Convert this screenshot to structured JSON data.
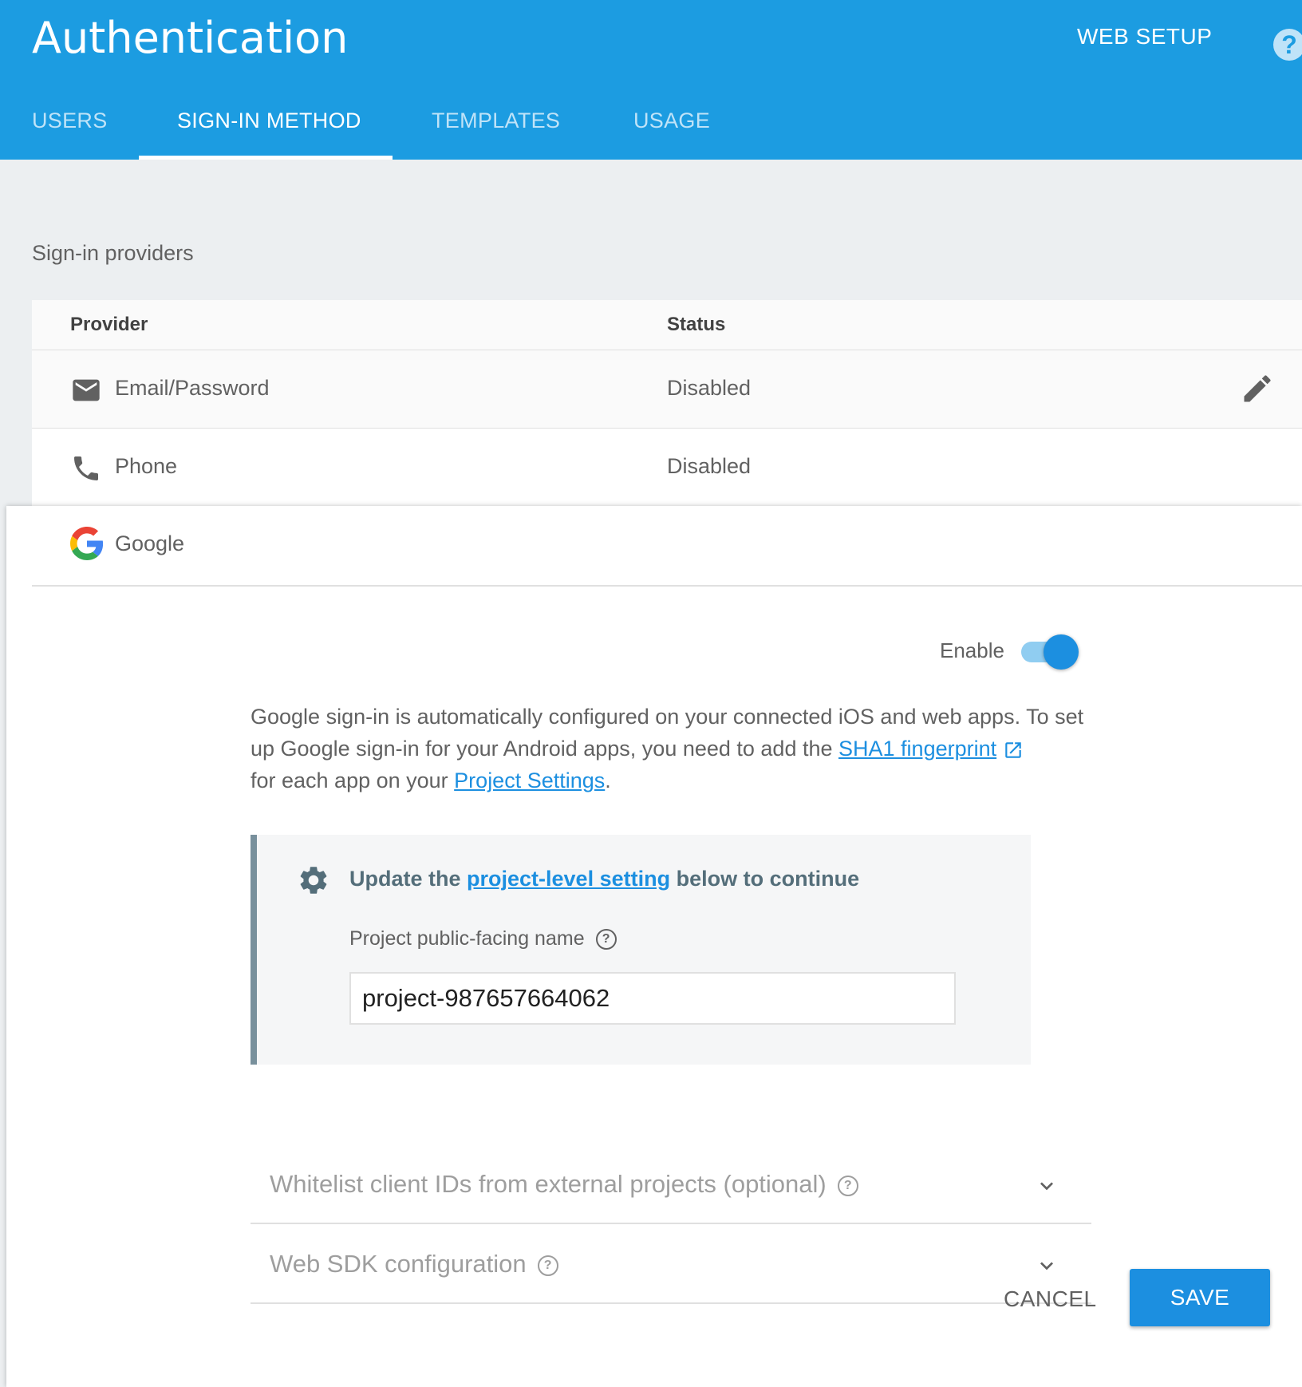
{
  "header": {
    "title": "Authentication",
    "web_setup": "WEB SETUP",
    "help": "?",
    "tabs": [
      {
        "label": "USERS"
      },
      {
        "label": "SIGN-IN METHOD",
        "active": true
      },
      {
        "label": "TEMPLATES"
      },
      {
        "label": "USAGE"
      }
    ]
  },
  "section_title": "Sign-in providers",
  "table": {
    "col_provider": "Provider",
    "col_status": "Status",
    "rows": [
      {
        "name": "Email/Password",
        "status": "Disabled",
        "icon": "mail-icon"
      },
      {
        "name": "Phone",
        "status": "Disabled",
        "icon": "phone-icon"
      }
    ]
  },
  "google_panel": {
    "name": "Google",
    "enable_label": "Enable",
    "enabled": true,
    "desc_part1": "Google sign-in is automatically configured on your connected iOS and web apps. To set up Google sign-in for your Android apps, you need to add the ",
    "desc_link1": "SHA1 fingerprint",
    "desc_part2": " for each app on your ",
    "desc_link2": "Project Settings",
    "desc_part3": ".",
    "callout": {
      "heading_part1": "Update the ",
      "heading_link": "project-level setting",
      "heading_part2": " below to continue",
      "field_label": "Project public-facing name",
      "field_value": "project-987657664062"
    },
    "accordions": [
      {
        "label": "Whitelist client IDs from external projects (optional)"
      },
      {
        "label": "Web SDK configuration"
      }
    ],
    "cancel": "CANCEL",
    "save": "SAVE"
  },
  "colors": {
    "header_blue": "#1c9ce1",
    "accent_blue": "#1c8fe0",
    "page_bg": "#eceff1"
  }
}
